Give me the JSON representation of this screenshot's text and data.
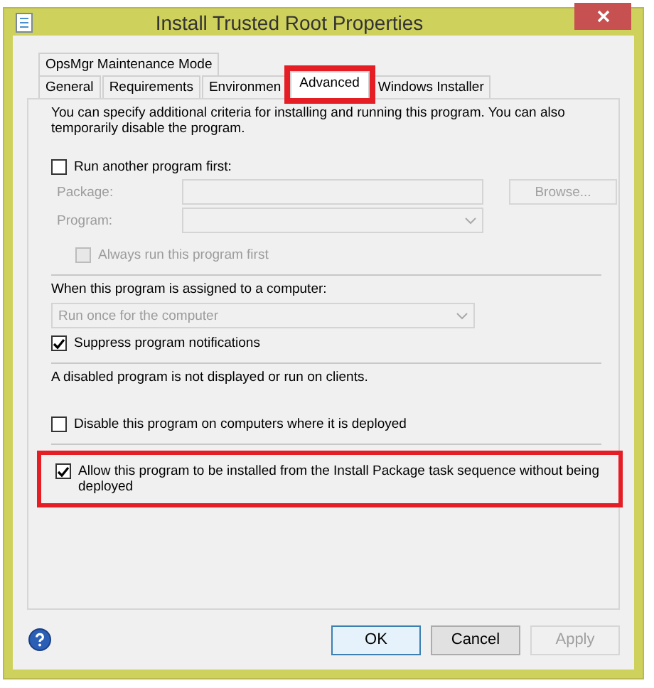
{
  "window": {
    "title": "Install Trusted Root Properties"
  },
  "tab_rows": [
    {
      "tabs": [
        {
          "label": "OpsMgr Maintenance Mode",
          "selected": false,
          "highlighted": false
        }
      ]
    },
    {
      "tabs": [
        {
          "label": "General",
          "selected": false,
          "highlighted": false
        },
        {
          "label": "Requirements",
          "selected": false,
          "highlighted": false
        },
        {
          "label": "Environmen",
          "selected": false,
          "highlighted": false
        },
        {
          "label": "Advanced",
          "selected": true,
          "highlighted": true
        },
        {
          "label": "Windows Installer",
          "selected": false,
          "highlighted": false
        }
      ]
    }
  ],
  "intro": "You can specify additional criteria for installing and running this program. You can also temporarily disable the program.",
  "run_another": {
    "label": "Run another program first:",
    "checked": false
  },
  "package": {
    "label": "Package:",
    "disabled": true
  },
  "browse": {
    "label": "Browse...",
    "disabled": true
  },
  "program": {
    "label": "Program:",
    "disabled": true
  },
  "always_run": {
    "label": "Always run this program first",
    "checked": false,
    "disabled": true
  },
  "assigned_label": "When this program is assigned to a computer:",
  "assigned_select": {
    "value": "Run once for the computer",
    "disabled": true
  },
  "suppress": {
    "label": "Suppress program notifications",
    "checked": true
  },
  "disabled_note": "A disabled program is not displayed or run on clients.",
  "disable_program": {
    "label": "Disable this program on computers where it is deployed",
    "checked": false
  },
  "allow_install": {
    "label": "Allow this program to be installed from the Install Package task sequence without being deployed",
    "checked": true,
    "highlighted": true
  },
  "buttons": [
    {
      "label": "OK",
      "kind": "default",
      "disabled": false
    },
    {
      "label": "Cancel",
      "kind": "normal",
      "disabled": false
    },
    {
      "label": "Apply",
      "kind": "normal",
      "disabled": true
    }
  ]
}
